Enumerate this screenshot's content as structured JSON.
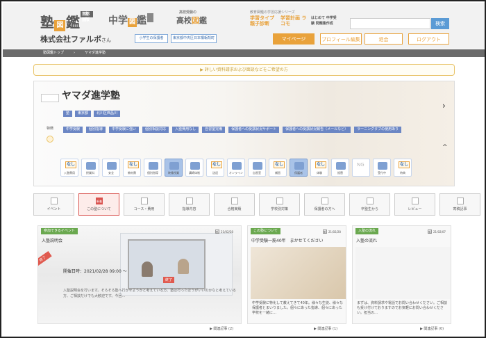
{
  "header": {
    "logo_juku": {
      "pre": "塾",
      "mid": "図",
      "post": "鑑",
      "tag": "首都圏版"
    },
    "logo_chugaku": {
      "pre": "中学",
      "mid": "図",
      "post": "鑑"
    },
    "logo_koko": {
      "small": "高校受験の",
      "main": "高校",
      "mid": "図",
      "post": "鑑"
    },
    "series_title": "教育図鑑の学習応援シリーズ",
    "series": [
      "学習タイプ 親子診断",
      "学習計画 ラコモ",
      "はじめて 中学受験 問題集作成"
    ],
    "search_button": "検索",
    "company_name": "株式会社ファルボ",
    "company_suffix": "さん",
    "links": [
      "小学生の保護者",
      "東京都中央区日本橋蛎殻町"
    ],
    "nav": [
      "マイページ",
      "プロフィール編集",
      "退会",
      "ログアウト"
    ]
  },
  "breadcrumb": [
    "塾図鑑トップ",
    "ヤマダ進学塾"
  ],
  "notice": "▶ 詳しい資料請求および面談などをご希望の方",
  "school": {
    "logo_text": "ヤマダ進学塾",
    "name": "ヤマダ進学塾",
    "tags": [
      "塾",
      "東京都",
      "北川区西品川"
    ],
    "feature_label": "特徴",
    "features": [
      "中学受験",
      "個別指導",
      "中学受験に強い",
      "個別相談対応",
      "入塾費用なし",
      "自習室完備",
      "保護者への受講状況サポート",
      "保護者への受講状況報告（メールなど）",
      "ラーニングタブの使用あり"
    ],
    "icons": [
      {
        "label": "入塾費用",
        "type": "nashi"
      },
      {
        "label": "授業料",
        "type": "blue"
      },
      {
        "label": "安全",
        "type": "blue"
      },
      {
        "label": "教材費",
        "type": "nashi"
      },
      {
        "label": "個別指導",
        "type": "blue"
      },
      {
        "label": "映像授業",
        "type": "on"
      },
      {
        "label": "講師体制",
        "type": "blue"
      },
      {
        "label": "送迎",
        "type": "nashi"
      },
      {
        "label": "オンライン",
        "type": "blue"
      },
      {
        "label": "自習室",
        "type": "blue"
      },
      {
        "label": "補習",
        "type": "nashi"
      },
      {
        "label": "保護者",
        "type": "on"
      },
      {
        "label": "体験",
        "type": "nashi"
      },
      {
        "label": "振替",
        "type": "blue"
      },
      {
        "label": "NG",
        "type": "ng"
      },
      {
        "label": "受付中",
        "type": "blue"
      },
      {
        "label": "特典",
        "type": "nashi"
      }
    ]
  },
  "tabs": [
    {
      "label": "イベント",
      "badge": ""
    },
    {
      "label": "この塾について",
      "badge": "新着"
    },
    {
      "label": "コース・費用",
      "badge": ""
    },
    {
      "label": "指導内容",
      "badge": ""
    },
    {
      "label": "合格実績",
      "badge": ""
    },
    {
      "label": "学校別対策",
      "badge": ""
    },
    {
      "label": "保護者の方へ",
      "badge": ""
    },
    {
      "label": "卒塾生から",
      "badge": ""
    },
    {
      "label": "レビュー",
      "badge": ""
    },
    {
      "label": "寄稿記事",
      "badge": ""
    }
  ],
  "cards": [
    {
      "label": "参加できるイベント",
      "title": "入塾説明会",
      "date_icon": "新",
      "date": "21/02/28",
      "end_badge": "終了",
      "end_badge2": "終了",
      "event_date": "開催日時：2021/02/28 09:00 ～",
      "body": "入塾説明会を行います。そろそろ塾へ行かせようかと考えている方、塾は行ったほうがいいのかなと考えている方、ご相談だけでも大歓迎です。今回…",
      "related": "▶ 関連記事 (2)"
    },
    {
      "label": "この塾について",
      "title": "中学受験一筋40年　まかせてください",
      "date_icon": "新",
      "date": "21/02/28",
      "body": "中学受験に特化して教えてきて40年。様々な生徒、様々な保護者とまいりました。個々にあった指導、個々にあった学校を一緒に…",
      "related": "▶ 関連記事 (1)"
    },
    {
      "label": "入塾の流れ",
      "title": "入塾の流れ",
      "date_icon": "新",
      "date": "21/02/07",
      "body": "まずは、資料請求や電話でお問い合わせください。ご相談も受け付けておりますのでお気軽にお問い合わせください。担当の…",
      "related": "▶ 関連記事 (0)"
    }
  ],
  "colors": {
    "accent": "#e9a23b",
    "blue": "#5b9bd5",
    "tag": "#6b86c4",
    "active_tab": "#d9534f",
    "label_green": "#6aa84f"
  }
}
